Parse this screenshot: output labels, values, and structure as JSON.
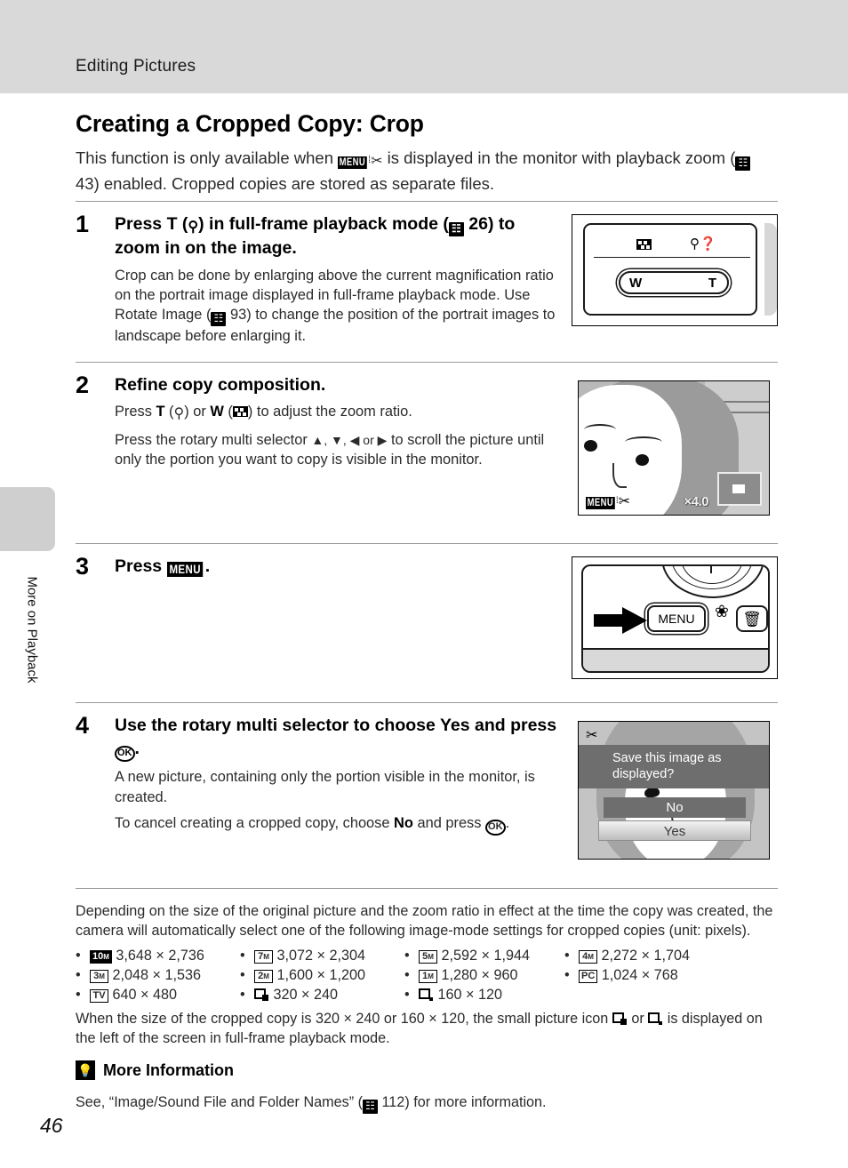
{
  "header": {
    "running_head": "Editing Pictures"
  },
  "sidebar": {
    "tab_label": "More on Playback"
  },
  "page": {
    "number": "46"
  },
  "section": {
    "title": "Creating a Cropped Copy: Crop",
    "intro_part1": "This function is only available when",
    "intro_menu_icon": "MENU",
    "intro_scissors_icon": "scissors-icon",
    "intro_part2": "is displayed in the monitor with playback zoom (",
    "intro_ref_page": "43",
    "intro_part3": ") enabled. Cropped copies are stored as separate files."
  },
  "steps": [
    {
      "number": "1",
      "head_part1": "Press",
      "head_t": "T",
      "head_mag": "magnifier-icon",
      "head_part2": "in full-frame playback mode (",
      "head_ref": "26",
      "head_part3": ") to zoom in on the image.",
      "body_part1": "Crop can be done by enlarging above the current magnification ratio on the portrait image displayed in full-frame playback mode. Use Rotate Image (",
      "body_ref": "93",
      "body_part2": ") to change the position of the portrait images to landscape before enlarging it.",
      "figure": {
        "name": "camera-zoom-control",
        "zoom_wide_label": "W",
        "zoom_tele_label": "T"
      }
    },
    {
      "number": "2",
      "head": "Refine copy composition.",
      "body1_part1": "Press",
      "body1_t": "T",
      "body1_mag": "magnifier-icon",
      "body1_or": "or",
      "body1_w": "W",
      "body1_thumb": "thumbnail-icon",
      "body1_part2": "to adjust the zoom ratio.",
      "body2_part1": "Press the rotary multi selector",
      "body2_arrows": "▲, ▼, ◀ or ▶",
      "body2_part2": "to scroll the picture until only the portion you want to copy is visible in the monitor.",
      "figure": {
        "name": "monitor-crop-preview",
        "menu_icon": "MENU",
        "scissors_icon": "scissors-icon",
        "zoom_ratio": "×4.0"
      }
    },
    {
      "number": "3",
      "head_part1": "Press",
      "head_menu": "MENU",
      "head_part2": ".",
      "figure": {
        "name": "camera-back-menu-button",
        "menu_button_label": "MENU",
        "macro_icon": "macro-flower-icon",
        "delete_icon": "trash-icon"
      }
    },
    {
      "number": "4",
      "head_part1": "Use the rotary multi selector to choose",
      "head_yes": "Yes",
      "head_part2": "and press",
      "head_ok": "OK",
      "head_part3": ".",
      "body1": "A new picture, containing only the portion visible in the monitor, is created.",
      "body2_part1": "To cancel creating a cropped copy, choose",
      "body2_no": "No",
      "body2_part2": "and press",
      "body2_ok": "OK",
      "body2_part3": ".",
      "figure": {
        "name": "monitor-save-dialog",
        "scissors_icon": "scissors-icon",
        "prompt": "Save this image as displayed?",
        "option_no": "No",
        "option_yes": "Yes",
        "selected_option": "Yes"
      }
    }
  ],
  "notes": {
    "image_mode_intro": "Depending on the size of the original picture and the zoom ratio in effect at the time the copy was created, the camera will automatically select one of the following image-mode settings for cropped copies (unit: pixels).",
    "small_icon_note_part1": "When the size of the cropped copy is 320 × 240 or 160 × 120, the small picture icon",
    "small_icon_note_or": "or",
    "small_icon_note_part2": "is displayed on the left of the screen in full-frame playback mode."
  },
  "image_modes": [
    {
      "badge": "10",
      "badge_sub": "M",
      "badge_style": "filled",
      "size": "3,648 × 2,736"
    },
    {
      "badge": "7",
      "badge_sub": "M",
      "badge_style": "outline",
      "size": "3,072 × 2,304"
    },
    {
      "badge": "5",
      "badge_sub": "M",
      "badge_style": "outline",
      "size": "2,592 × 1,944"
    },
    {
      "badge": "4",
      "badge_sub": "M",
      "badge_style": "outline",
      "size": "2,272 × 1,704"
    },
    {
      "badge": "3",
      "badge_sub": "M",
      "badge_style": "outline",
      "size": "2,048 × 1,536"
    },
    {
      "badge": "2",
      "badge_sub": "M",
      "badge_style": "outline",
      "size": "1,600 × 1,200"
    },
    {
      "badge": "1",
      "badge_sub": "M",
      "badge_style": "outline",
      "size": "1,280 × 960"
    },
    {
      "badge": "PC",
      "badge_sub": "",
      "badge_style": "outline",
      "size": "1,024 × 768"
    },
    {
      "badge": "TV",
      "badge_sub": "",
      "badge_style": "outline",
      "size": "640 × 480"
    },
    {
      "badge": "small-picture-icon",
      "badge_sub": "",
      "badge_style": "small",
      "size": "320 × 240"
    },
    {
      "badge": "small-picture-icon",
      "badge_sub": "",
      "badge_style": "small",
      "size": "160 × 120"
    }
  ],
  "more_information": {
    "icon": "lightbulb-icon",
    "title": "More Information",
    "text_part1": "See, “Image/Sound File and Folder Names” (",
    "ref_page": "112",
    "text_part2": ") for more information."
  }
}
